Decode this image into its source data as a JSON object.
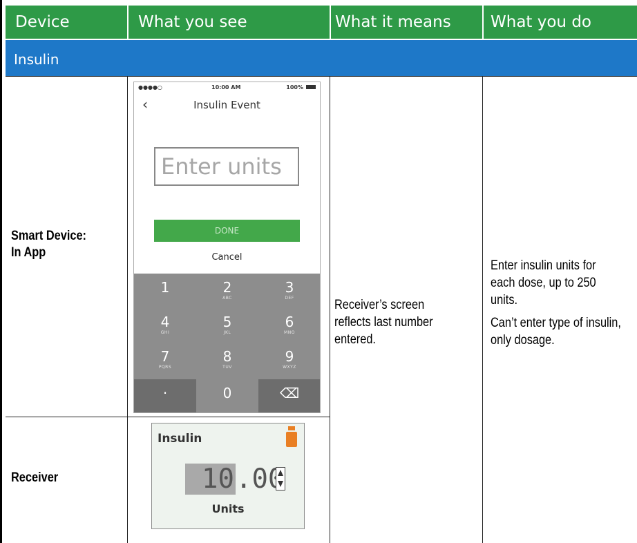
{
  "colors": {
    "header_green": "#2e9a47",
    "section_blue": "#1e78c8",
    "done_green": "#43a84a",
    "vial_orange": "#e97f24"
  },
  "header": {
    "device": "Device",
    "what_you_see": "What you see",
    "what_it_means": "What it means",
    "what_you_do": "What you do"
  },
  "section": {
    "title": "Insulin"
  },
  "rows": {
    "smart_device": {
      "label_line1": "Smart Device:",
      "label_line2": "In App"
    },
    "receiver": {
      "label": "Receiver"
    }
  },
  "what_it_means": "Receiver’s screen reflects last number entered.",
  "what_you_do": {
    "p1": "Enter insulin units for each dose, up to 250 units.",
    "p2": "Can’t enter type of insulin, only dosage."
  },
  "phone": {
    "status_left": "●●●●○",
    "status_time": "10:00 AM",
    "status_battery": "100%",
    "back_icon": "‹",
    "title": "Insulin Event",
    "input_placeholder": "Enter units",
    "done_label": "DONE",
    "cancel_label": "Cancel",
    "keys": [
      {
        "num": "1",
        "letters": ""
      },
      {
        "num": "2",
        "letters": "ABC"
      },
      {
        "num": "3",
        "letters": "DEF"
      },
      {
        "num": "4",
        "letters": "GHI"
      },
      {
        "num": "5",
        "letters": "JKL"
      },
      {
        "num": "6",
        "letters": "MNO"
      },
      {
        "num": "7",
        "letters": "PQRS"
      },
      {
        "num": "8",
        "letters": "TUV"
      },
      {
        "num": "9",
        "letters": "WXYZ"
      },
      {
        "num": "·",
        "letters": ""
      },
      {
        "num": "0",
        "letters": ""
      },
      {
        "num": "⌫",
        "letters": ""
      }
    ]
  },
  "receiver_screen": {
    "title": "Insulin",
    "value_int": "10",
    "value_frac": ".00",
    "units": "Units"
  }
}
